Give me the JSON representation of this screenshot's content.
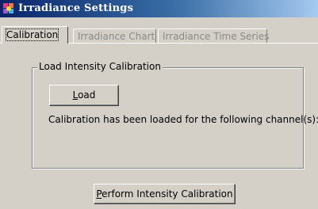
{
  "window": {
    "title": "Irradiance Settings",
    "app_icon": "colorful-grid-app-icon"
  },
  "tabs": [
    {
      "label": "Calibration",
      "active": true
    },
    {
      "label": "Irradiance Chart",
      "active": false
    },
    {
      "label": "Irradiance Time Series",
      "active": false
    }
  ],
  "group": {
    "legend": "Load Intensity Calibration",
    "load_button": {
      "mnemonic": "L",
      "rest": "oad"
    },
    "status": "Calibration has been loaded for the following channel(s):"
  },
  "perform_button": {
    "mnemonic": "P",
    "rest": "erform Intensity Calibration"
  },
  "colors": {
    "title_bar_start": "#0a246a",
    "title_bar_end": "#a6caf0",
    "face": "#d4d0c8",
    "inactive_tab_text": "#8a8a8a"
  }
}
